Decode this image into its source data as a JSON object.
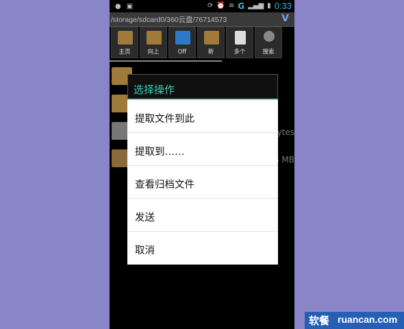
{
  "status_bar": {
    "time": "0:33",
    "network": "G"
  },
  "path_bar": {
    "path": "/storage/sdcard0/360云盘/76714573",
    "logo": "V"
  },
  "toolbar": {
    "buttons": [
      {
        "label": "主页",
        "icon": "home-folder-icon"
      },
      {
        "label": "向上",
        "icon": "up-folder-icon"
      },
      {
        "label": "Off",
        "icon": "dropbox-icon"
      },
      {
        "label": "新",
        "icon": "new-folder-icon"
      },
      {
        "label": "多个",
        "icon": "multi-select-icon"
      },
      {
        "label": "搜索",
        "icon": "search-icon"
      }
    ]
  },
  "file_list": {
    "rows": [
      {
        "icon": "folder-up-icon",
        "meta": ""
      },
      {
        "icon": "folder-icon",
        "meta": ""
      },
      {
        "icon": "txt-file-icon",
        "meta": "ytes"
      },
      {
        "icon": "archive-file-icon",
        "meta": "B MB"
      }
    ]
  },
  "dialog": {
    "title": "选择操作",
    "items": [
      "提取文件到此",
      "提取到……",
      "查看归档文件",
      "发送",
      "取消"
    ]
  },
  "watermark": {
    "cn": "软餐",
    "en": "ruancan.com"
  },
  "colors": {
    "accent": "#3ad1b6",
    "background": "#8a84c8",
    "status_blue": "#33b5e5"
  }
}
